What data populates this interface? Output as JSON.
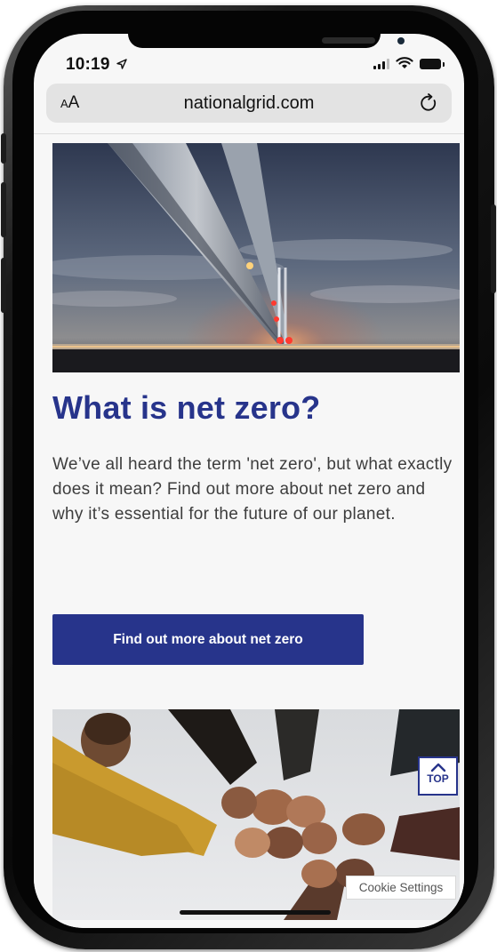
{
  "status_bar": {
    "time": "10:19",
    "location_icon": "location-arrow-icon",
    "signal_icon": "cellular-signal-icon",
    "wifi_icon": "wifi-icon",
    "battery_icon": "battery-icon"
  },
  "browser": {
    "text_size_label_small": "A",
    "text_size_label_large": "A",
    "url": "nationalgrid.com",
    "reload_icon": "reload-icon"
  },
  "article": {
    "hero_image": "suspension-bridge-at-night-photo",
    "title": "What is net zero?",
    "body": "We’ve all heard the term 'net zero', but what exactly does it mean? Find out more about net zero and why it’s essential for the future of our planet.",
    "cta_label": "Find out more about net zero",
    "second_image": "team-fist-bump-photo"
  },
  "floating": {
    "top_label": "TOP",
    "top_icon": "chevron-up-icon",
    "cookie_label": "Cookie Settings"
  },
  "colors": {
    "brand_blue": "#27348b",
    "body_text": "#3d3d3d",
    "page_bg": "#f7f7f7",
    "url_bar_bg": "#e3e3e3"
  }
}
